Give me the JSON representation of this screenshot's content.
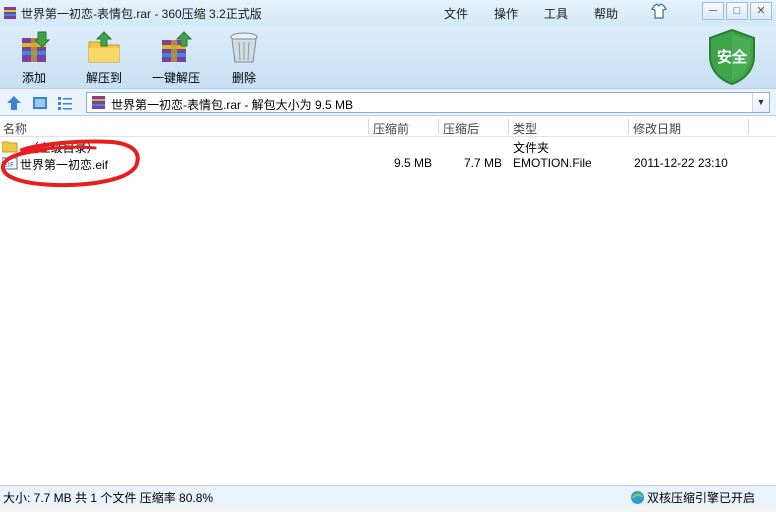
{
  "window": {
    "title": "世界第一初恋-表情包.rar - 360压缩 3.2正式版",
    "menu": [
      "文件",
      "操作",
      "工具",
      "帮助"
    ],
    "minimize": "─",
    "restore": "□",
    "close": "✕"
  },
  "toolbar": {
    "add": "添加",
    "extract_to": "解压到",
    "one_click": "一键解压",
    "delete": "删除",
    "security_badge": "安全"
  },
  "address": {
    "path": "世界第一初恋-表情包.rar - 解包大小为 9.5 MB"
  },
  "columns": {
    "name": "名称",
    "packed": "压缩前",
    "unpacked": "压缩后",
    "type": "类型",
    "modified": "修改日期"
  },
  "rows": [
    {
      "name": "..（上级目录）",
      "packed": "",
      "unpacked": "",
      "type": "文件夹",
      "modified": ""
    },
    {
      "name": "世界第一初恋.eif",
      "packed": "9.5 MB",
      "unpacked": "7.7 MB",
      "type": "EMOTION.File",
      "modified": "2011-12-22 23:10"
    }
  ],
  "status": {
    "summary": "大小: 7.7 MB 共 1 个文件 压缩率 80.8%",
    "engine": "双核压缩引擎已开启"
  },
  "colors": {
    "titlebar": "#d4e8f7",
    "toolbar": "#c7dff3",
    "shield": "#3fa34a",
    "annotation": "#e81e1e"
  }
}
